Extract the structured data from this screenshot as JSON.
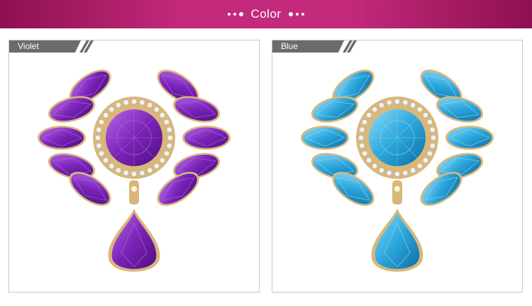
{
  "banner": {
    "title": "Color",
    "background": "#b51f6d"
  },
  "variants": [
    {
      "label": "Violet",
      "gem": "#7a23b8",
      "gem_light": "#b46be6",
      "gem_dark": "#4d0f80"
    },
    {
      "label": "Blue",
      "gem": "#2aa6dc",
      "gem_light": "#8fdaf7",
      "gem_dark": "#0e6fa3"
    }
  ],
  "colors": {
    "metal": "#d9b77a",
    "rhinestone": "#f2f2f2",
    "tag": "#6b6b6b"
  }
}
